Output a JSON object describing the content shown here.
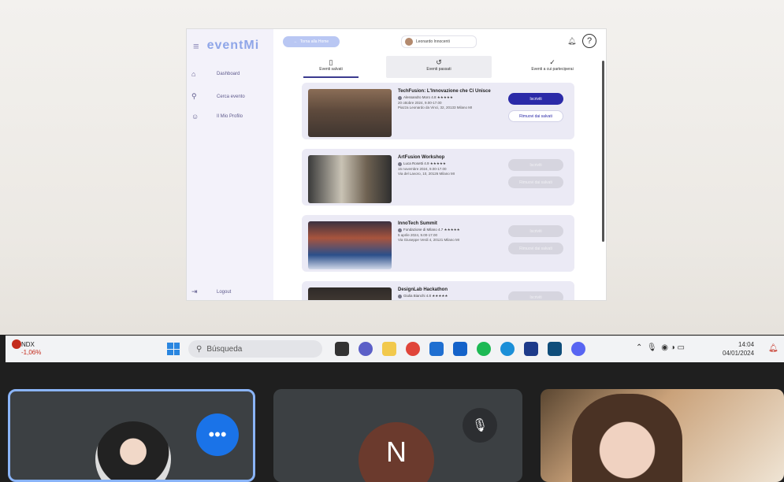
{
  "app": {
    "logo": "eventMi",
    "sidebar": [
      {
        "label": "Dashboard",
        "icon": "home-icon"
      },
      {
        "label": "Cerca evento",
        "icon": "search-icon"
      },
      {
        "label": "Il Mio Profilo",
        "icon": "user-icon"
      }
    ],
    "logout": "Logout",
    "back": "Torna alla Home",
    "user": "Leonardo Innocenti",
    "tabs": [
      "Eventi salvati",
      "Eventi passati",
      "Eventi a cui parteciperai"
    ],
    "events": [
      {
        "title": "TechFusion: L'Innovazione che Ci Unisce",
        "org": "Alessandro Moro 4.8 ★★★★★",
        "date": "20 ottobre 2024, 9.00-17.00",
        "place": "Piazza Leonardo da Vinci, 32, 20133 Milano MI",
        "btn1": "Iscriviti",
        "btn2": "Rimuovi dai salvati"
      },
      {
        "title": "ArtFusion Workshop",
        "org": "Luca Rosetti 4.9 ★★★★★",
        "date": "15 novembre 2024, 9.00-17.00",
        "place": "Via del Lavoro, 10, 20126 Milano MI",
        "btn1": "Iscriviti",
        "btn2": "Rimuovi dai salvati"
      },
      {
        "title": "InnoTech Summit",
        "org": "Fondazione di Milano 4.7 ★★★★★",
        "date": "5 aprile 2024, 9.00-17.00",
        "place": "Via Giuseppe Verdi 4, 20121 Milano MI",
        "btn1": "Iscriviti",
        "btn2": "Rimuovi dai salvati"
      },
      {
        "title": "DesignLab Hackathon",
        "org": "Giulia Bianchi 4.8 ★★★★★",
        "date": "",
        "place": "",
        "btn1": "Iscriviti",
        "btn2": ""
      }
    ]
  },
  "taskbar": {
    "stock_name": "NDX",
    "stock_change": "-1,06%",
    "search_placeholder": "Búsqueda",
    "time": "14:04",
    "date": "04/01/2024"
  },
  "meeting": {
    "tile2_initial": "N"
  }
}
